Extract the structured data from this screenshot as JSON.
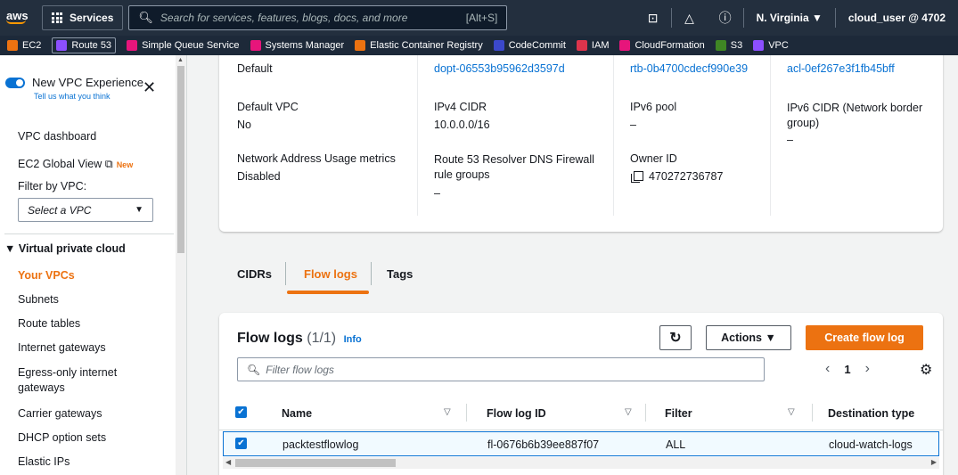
{
  "topnav": {
    "logo": "aws",
    "services_label": "Services",
    "search_placeholder": "Search for services, features, blogs, docs, and more",
    "search_shortcut": "[Alt+S]",
    "region": "N. Virginia ▼",
    "account": "cloud_user @ 4702"
  },
  "favorites": [
    {
      "label": "EC2",
      "color": "#ec7211"
    },
    {
      "label": "Route 53",
      "color": "#8c4fff",
      "boxed": true
    },
    {
      "label": "Simple Queue Service",
      "color": "#e7157b"
    },
    {
      "label": "Systems Manager",
      "color": "#e7157b"
    },
    {
      "label": "Elastic Container Registry",
      "color": "#ec7211"
    },
    {
      "label": "CodeCommit",
      "color": "#3b48cc"
    },
    {
      "label": "IAM",
      "color": "#dd344c"
    },
    {
      "label": "CloudFormation",
      "color": "#e7157b"
    },
    {
      "label": "S3",
      "color": "#3f8624"
    },
    {
      "label": "VPC",
      "color": "#8c4fff"
    }
  ],
  "sidebar": {
    "new_experience": "New VPC Experience",
    "feedback": "Tell us what you think",
    "vpc_dashboard": "VPC dashboard",
    "ec2_global_view": "EC2 Global View",
    "new_badge": "New",
    "filter_label": "Filter by VPC:",
    "filter_placeholder": "Select a VPC",
    "section": "Virtual private cloud",
    "items": [
      "Your VPCs",
      "Subnets",
      "Route tables",
      "Internet gateways",
      "Egress-only internet gateways",
      "Carrier gateways",
      "DHCP option sets",
      "Elastic IPs"
    ]
  },
  "details": {
    "tenancy_value": "Default",
    "dhcp_value": "dopt-06553b95962d3597d",
    "route_table_value": "rtb-0b4700cdecf990e39",
    "acl_value": "acl-0ef267e3f1fb45bff",
    "default_vpc_label": "Default VPC",
    "default_vpc_value": "No",
    "ipv4_label": "IPv4 CIDR",
    "ipv4_value": "10.0.0.0/16",
    "ipv6_pool_label": "IPv6 pool",
    "ipv6_pool_value": "–",
    "ipv6_cidr_label": "IPv6 CIDR (Network border group)",
    "ipv6_cidr_value": "–",
    "nau_label": "Network Address Usage metrics",
    "nau_value": "Disabled",
    "dns_fw_label": "Route 53 Resolver DNS Firewall rule groups",
    "dns_fw_value": "–",
    "owner_label": "Owner ID",
    "owner_value": "470272736787"
  },
  "tabs": [
    "CIDRs",
    "Flow logs",
    "Tags"
  ],
  "flowlogs": {
    "title": "Flow logs",
    "count": "(1/1)",
    "info": "Info",
    "actions": "Actions ▼",
    "create": "Create flow log",
    "filter_placeholder": "Filter flow logs",
    "page": "1",
    "columns": [
      "Name",
      "Flow log ID",
      "Filter",
      "Destination type"
    ],
    "rows": [
      {
        "name": "packtestflowlog",
        "id": "fl-0676b6b39ee887f07",
        "filter": "ALL",
        "dest": "cloud-watch-logs"
      }
    ]
  }
}
